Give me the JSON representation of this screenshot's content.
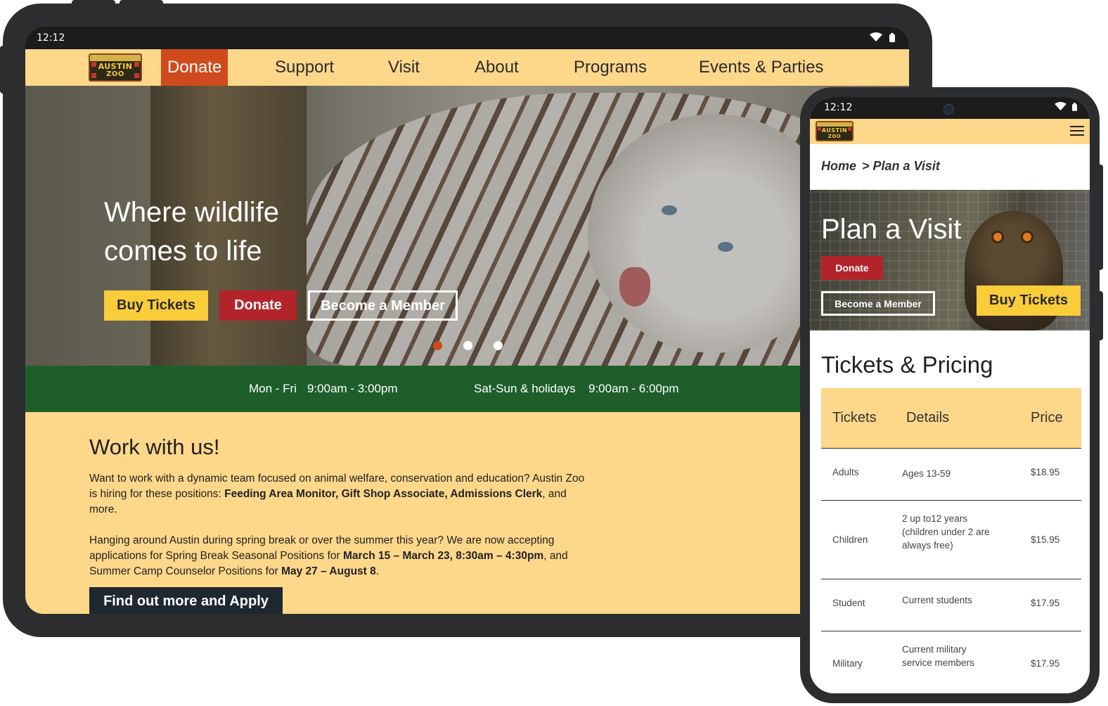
{
  "logo": {
    "line1": "AUSTIN",
    "line2": "ZOO"
  },
  "colors": {
    "navbar": "#fdd78a",
    "donate_orange": "#cf4a1c",
    "donate_red": "#b3242a",
    "ticket_yellow": "#f9cc3a",
    "hours_green": "#1e5e2b",
    "cta_dark": "#1f2730"
  },
  "tablet": {
    "status": {
      "time": "12:12",
      "icons": [
        "wifi-icon",
        "battery-icon"
      ]
    },
    "nav": {
      "donate": "Donate",
      "support": "Support",
      "visit": "Visit",
      "about": "About",
      "programs": "Programs",
      "events": "Events & Parties"
    },
    "hero": {
      "title": "Where wildlife comes to life",
      "buy_tickets": "Buy Tickets",
      "donate": "Donate",
      "member": "Become a Member",
      "carousel": {
        "count": 3,
        "active_index": 0
      }
    },
    "hours": {
      "weekday_label": "Mon - Fri",
      "weekday_time": "9:00am - 3:00pm",
      "weekend_label": "Sat-Sun & holidays",
      "weekend_time": "9:00am - 6:00pm"
    },
    "work": {
      "heading": "Work with us!",
      "p1_a": "Want to work with a dynamic team focused on animal welfare, conservation and education? Austin Zoo is hiring for these positions: ",
      "p1_b": "Feeding Area Monitor, Gift Shop Associate, Admissions Clerk",
      "p1_c": ", and more.",
      "p2_a": "Hanging around Austin during spring break or over the summer this year? We are now accepting applications for Spring Break Seasonal Positions for ",
      "p2_b": "March 15 – March 23, 8:30am – 4:30pm",
      "p2_c": ", and Summer Camp Counselor Positions for ",
      "p2_d": "May 27 – August 8",
      "p2_e": ".",
      "cta": "Find out more and Apply"
    }
  },
  "phone": {
    "status": {
      "time": "12:12",
      "icons": [
        "wifi-icon",
        "battery-icon"
      ]
    },
    "breadcrumb": {
      "home": "Home",
      "current": "> Plan a Visit"
    },
    "hero": {
      "title": "Plan a Visit",
      "donate": "Donate",
      "member": "Become a Member",
      "buy_tickets": "Buy Tickets"
    },
    "tickets": {
      "heading": "Tickets & Pricing",
      "columns": [
        "Tickets",
        "Details",
        "Price"
      ],
      "rows": [
        {
          "ticket": "Adults",
          "details": "Ages 13-59",
          "price": "$18.95"
        },
        {
          "ticket": "Children",
          "details": "2 up to12 years (children under 2 are always free)",
          "price": "$15.95"
        },
        {
          "ticket": "Student",
          "details": "Current students",
          "price": "$17.95"
        },
        {
          "ticket": "Military",
          "details": "Current military service members",
          "price": "$17.95"
        }
      ]
    }
  }
}
